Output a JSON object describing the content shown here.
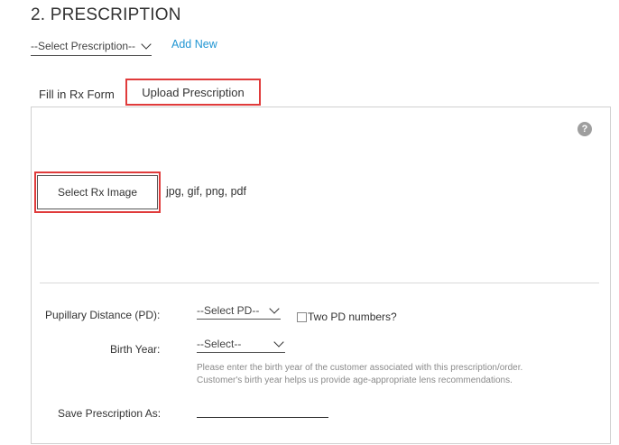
{
  "section": {
    "title": "2. PRESCRIPTION"
  },
  "prescription_select": {
    "value": "--Select Prescription--"
  },
  "add_new_label": "Add New",
  "tabs": [
    {
      "label": "Fill in Rx Form"
    },
    {
      "label": "Upload Prescription",
      "active": true
    }
  ],
  "upload": {
    "help_label": "?",
    "select_button_label": "Select Rx Image",
    "file_types": "jpg, gif, png, pdf"
  },
  "form": {
    "pd_label": "Pupillary Distance (PD):",
    "pd_select_value": "--Select PD--",
    "two_pd_label": "Two PD numbers?",
    "birth_year_label": "Birth Year:",
    "birth_year_value": "--Select--",
    "birth_year_note_1": "Please enter the birth year of the customer associated with this prescription/order.",
    "birth_year_note_2": "Customer's birth year helps us provide age-appropriate lens recommendations.",
    "save_as_label": "Save Prescription As:",
    "save_as_value": ""
  },
  "colors": {
    "accent": "#2196d3",
    "highlight_border": "#e03b3b",
    "help_icon": "#9e9e9e"
  }
}
